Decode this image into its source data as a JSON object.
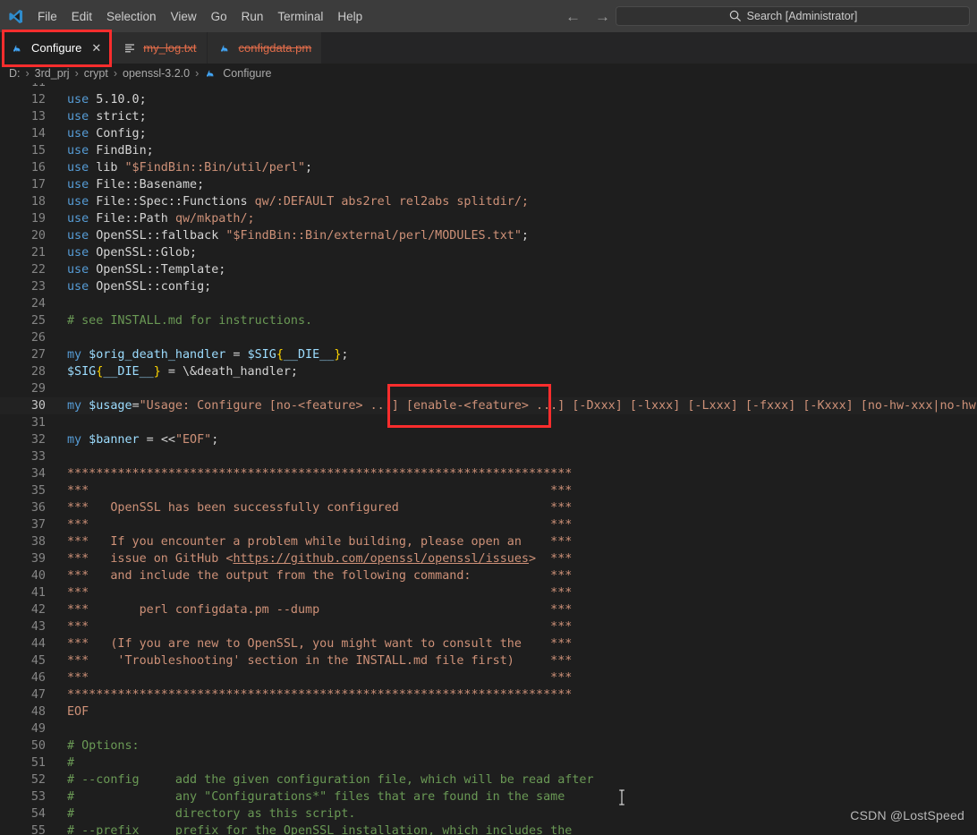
{
  "window": {
    "app_logo_icon": "vscode-logo-icon"
  },
  "menubar": {
    "items": [
      {
        "label": "File"
      },
      {
        "label": "Edit"
      },
      {
        "label": "Selection"
      },
      {
        "label": "View"
      },
      {
        "label": "Go"
      },
      {
        "label": "Run"
      },
      {
        "label": "Terminal"
      },
      {
        "label": "Help"
      }
    ]
  },
  "navigation": {
    "back_icon": "arrow-left-icon",
    "back_glyph": "←",
    "forward_icon": "arrow-right-icon",
    "forward_glyph": "→"
  },
  "search": {
    "icon": "search-icon",
    "text": "Search [Administrator]",
    "value": ""
  },
  "tabs": [
    {
      "label": "Configure",
      "icon": "perl-camel-icon",
      "active": true,
      "strikethrough": false,
      "close_label": "✕",
      "annotated": true
    },
    {
      "label": "my_log.txt",
      "icon": "text-file-icon",
      "active": false,
      "strikethrough": true,
      "close_label": "",
      "annotated": false
    },
    {
      "label": "configdata.pm",
      "icon": "perl-camel-icon",
      "active": false,
      "strikethrough": true,
      "close_label": "",
      "annotated": false
    }
  ],
  "breadcrumb": {
    "separator": "›",
    "items": [
      {
        "label": "D:",
        "icon": ""
      },
      {
        "label": "3rd_prj",
        "icon": ""
      },
      {
        "label": "crypt",
        "icon": ""
      },
      {
        "label": "openssl-3.2.0",
        "icon": ""
      },
      {
        "label": "Configure",
        "icon": "perl-camel-icon"
      }
    ]
  },
  "editor": {
    "language": "perl",
    "first_visible_line": 11,
    "current_line": 30,
    "lines": [
      {
        "n": 11,
        "clipped": true,
        "tokens": []
      },
      {
        "n": 12,
        "tokens": [
          {
            "t": "kw",
            "s": "use"
          },
          {
            "t": "pln",
            "s": " 5.10.0;"
          }
        ]
      },
      {
        "n": 13,
        "tokens": [
          {
            "t": "kw",
            "s": "use"
          },
          {
            "t": "pln",
            "s": " strict;"
          }
        ]
      },
      {
        "n": 14,
        "tokens": [
          {
            "t": "kw",
            "s": "use"
          },
          {
            "t": "pln",
            "s": " Config;"
          }
        ]
      },
      {
        "n": 15,
        "tokens": [
          {
            "t": "kw",
            "s": "use"
          },
          {
            "t": "pln",
            "s": " FindBin;"
          }
        ]
      },
      {
        "n": 16,
        "tokens": [
          {
            "t": "kw",
            "s": "use"
          },
          {
            "t": "pln",
            "s": " lib "
          },
          {
            "t": "str",
            "s": "\"$FindBin::Bin/util/perl\""
          },
          {
            "t": "pln",
            "s": ";"
          }
        ]
      },
      {
        "n": 17,
        "tokens": [
          {
            "t": "kw",
            "s": "use"
          },
          {
            "t": "pln",
            "s": " File::Basename;"
          }
        ]
      },
      {
        "n": 18,
        "tokens": [
          {
            "t": "kw",
            "s": "use"
          },
          {
            "t": "pln",
            "s": " File::Spec::Functions "
          },
          {
            "t": "str",
            "s": "qw/:DEFAULT abs2rel rel2abs splitdir/;"
          }
        ]
      },
      {
        "n": 19,
        "tokens": [
          {
            "t": "kw",
            "s": "use"
          },
          {
            "t": "pln",
            "s": " File::Path "
          },
          {
            "t": "str",
            "s": "qw/mkpath/;"
          }
        ]
      },
      {
        "n": 20,
        "tokens": [
          {
            "t": "kw",
            "s": "use"
          },
          {
            "t": "pln",
            "s": " OpenSSL::fallback "
          },
          {
            "t": "str",
            "s": "\"$FindBin::Bin/external/perl/MODULES.txt\""
          },
          {
            "t": "pln",
            "s": ";"
          }
        ]
      },
      {
        "n": 21,
        "tokens": [
          {
            "t": "kw",
            "s": "use"
          },
          {
            "t": "pln",
            "s": " OpenSSL::Glob;"
          }
        ]
      },
      {
        "n": 22,
        "tokens": [
          {
            "t": "kw",
            "s": "use"
          },
          {
            "t": "pln",
            "s": " OpenSSL::Template;"
          }
        ]
      },
      {
        "n": 23,
        "tokens": [
          {
            "t": "kw",
            "s": "use"
          },
          {
            "t": "pln",
            "s": " OpenSSL::config;"
          }
        ]
      },
      {
        "n": 24,
        "tokens": []
      },
      {
        "n": 25,
        "tokens": [
          {
            "t": "cmt",
            "s": "# see INSTALL.md for instructions."
          }
        ]
      },
      {
        "n": 26,
        "tokens": []
      },
      {
        "n": 27,
        "tokens": [
          {
            "t": "kw",
            "s": "my"
          },
          {
            "t": "var",
            "s": " $orig_death_handler"
          },
          {
            "t": "op",
            "s": " = "
          },
          {
            "t": "var",
            "s": "$SIG"
          },
          {
            "t": "brc",
            "s": "{"
          },
          {
            "t": "var",
            "s": "__DIE__"
          },
          {
            "t": "brc",
            "s": "}"
          },
          {
            "t": "pln",
            "s": ";"
          }
        ]
      },
      {
        "n": 28,
        "tokens": [
          {
            "t": "var",
            "s": "$SIG"
          },
          {
            "t": "brc",
            "s": "{"
          },
          {
            "t": "var",
            "s": "__DIE__"
          },
          {
            "t": "brc",
            "s": "}"
          },
          {
            "t": "op",
            "s": " = "
          },
          {
            "t": "pln",
            "s": "\\&death_handler;"
          }
        ]
      },
      {
        "n": 29,
        "tokens": []
      },
      {
        "n": 30,
        "current": true,
        "tokens": [
          {
            "t": "kw",
            "s": "my"
          },
          {
            "t": "var",
            "s": " $usage"
          },
          {
            "t": "op",
            "s": "="
          },
          {
            "t": "str",
            "s": "\"Usage: Configure [no-<feature> ...] [enable-<feature> ...] [-Dxxx] [-lxxx] [-Lxxx] [-fxxx] [-Kxxx] [no-hw-xxx|no-hw] [[no"
          }
        ]
      },
      {
        "n": 31,
        "tokens": []
      },
      {
        "n": 32,
        "tokens": [
          {
            "t": "kw",
            "s": "my"
          },
          {
            "t": "var",
            "s": " $banner"
          },
          {
            "t": "op",
            "s": " = "
          },
          {
            "t": "pln",
            "s": "<<"
          },
          {
            "t": "str",
            "s": "\"EOF\""
          },
          {
            "t": "pln",
            "s": ";"
          }
        ]
      },
      {
        "n": 33,
        "tokens": []
      },
      {
        "n": 34,
        "tokens": [
          {
            "t": "str",
            "s": "**********************************************************************"
          }
        ]
      },
      {
        "n": 35,
        "tokens": [
          {
            "t": "str",
            "s": "***                                                                ***"
          }
        ]
      },
      {
        "n": 36,
        "tokens": [
          {
            "t": "str",
            "s": "***   OpenSSL has been successfully configured                     ***"
          }
        ]
      },
      {
        "n": 37,
        "tokens": [
          {
            "t": "str",
            "s": "***                                                                ***"
          }
        ]
      },
      {
        "n": 38,
        "tokens": [
          {
            "t": "str",
            "s": "***   If you encounter a problem while building, please open an    ***"
          }
        ]
      },
      {
        "n": 39,
        "link": true,
        "tokens": [
          {
            "t": "str",
            "s": "***   issue on GitHub <"
          },
          {
            "t": "lnk",
            "s": "https://github.com/openssl/openssl/issues"
          },
          {
            "t": "str",
            "s": ">  ***"
          }
        ]
      },
      {
        "n": 40,
        "tokens": [
          {
            "t": "str",
            "s": "***   and include the output from the following command:           ***"
          }
        ]
      },
      {
        "n": 41,
        "tokens": [
          {
            "t": "str",
            "s": "***                                                                ***"
          }
        ]
      },
      {
        "n": 42,
        "tokens": [
          {
            "t": "str",
            "s": "***       perl configdata.pm --dump                                ***"
          }
        ]
      },
      {
        "n": 43,
        "tokens": [
          {
            "t": "str",
            "s": "***                                                                ***"
          }
        ]
      },
      {
        "n": 44,
        "tokens": [
          {
            "t": "str",
            "s": "***   (If you are new to OpenSSL, you might want to consult the    ***"
          }
        ]
      },
      {
        "n": 45,
        "tokens": [
          {
            "t": "str",
            "s": "***    'Troubleshooting' section in the INSTALL.md file first)     ***"
          }
        ]
      },
      {
        "n": 46,
        "tokens": [
          {
            "t": "str",
            "s": "***                                                                ***"
          }
        ]
      },
      {
        "n": 47,
        "tokens": [
          {
            "t": "str",
            "s": "**********************************************************************"
          }
        ]
      },
      {
        "n": 48,
        "tokens": [
          {
            "t": "str",
            "s": "EOF"
          }
        ]
      },
      {
        "n": 49,
        "tokens": []
      },
      {
        "n": 50,
        "tokens": [
          {
            "t": "cmt",
            "s": "# Options:"
          }
        ]
      },
      {
        "n": 51,
        "tokens": [
          {
            "t": "cmt",
            "s": "#"
          }
        ]
      },
      {
        "n": 52,
        "tokens": [
          {
            "t": "cmt",
            "s": "# --config     add the given configuration file, which will be read after"
          }
        ]
      },
      {
        "n": 53,
        "tokens": [
          {
            "t": "cmt",
            "s": "#              any \"Configurations*\" files that are found in the same"
          }
        ]
      },
      {
        "n": 54,
        "tokens": [
          {
            "t": "cmt",
            "s": "#              directory as this script."
          }
        ]
      },
      {
        "n": 55,
        "tokens": [
          {
            "t": "cmt",
            "s": "# --prefix     prefix for the OpenSSL installation, which includes the"
          }
        ]
      }
    ]
  },
  "annotations": [
    {
      "name": "configure-tab-highlight",
      "color": "#fa2d2d"
    },
    {
      "name": "enable-feature-highlight",
      "color": "#fa2d2d"
    }
  ],
  "watermark": {
    "text": "CSDN @LostSpeed"
  },
  "colors": {
    "editor_bg": "#1e1e1e",
    "titlebar_bg": "#3c3c3c",
    "tabbar_bg": "#252526",
    "inactive_tab_bg": "#2d2d2d",
    "annotation": "#fa2d2d",
    "keyword": "#569cd6",
    "string": "#ce9178",
    "comment": "#6a9955",
    "variable": "#9cdcfe",
    "brace": "#ffd700",
    "linenumber": "#858585"
  }
}
